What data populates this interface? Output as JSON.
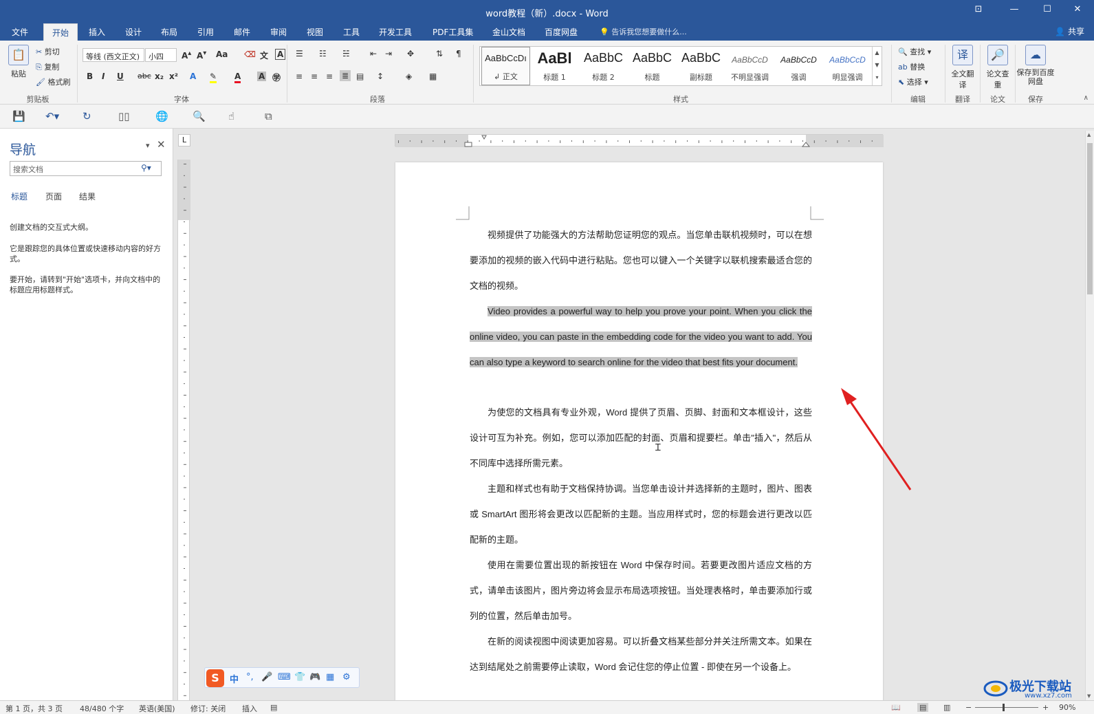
{
  "window": {
    "title": "word教程（新）.docx - Word",
    "controls": [
      "⊡",
      "—",
      "☐",
      "✕"
    ]
  },
  "tabs": [
    "文件",
    "开始",
    "插入",
    "设计",
    "布局",
    "引用",
    "邮件",
    "审阅",
    "视图",
    "工具",
    "开发工具",
    "PDF工具集",
    "金山文档",
    "百度网盘"
  ],
  "active_tab": "开始",
  "tellme": "告诉我您想要做什么...",
  "share": "共享",
  "ribbon": {
    "clipboard": {
      "paste": "粘贴",
      "cut": "剪切",
      "copy": "复制",
      "format_painter": "格式刷",
      "label": "剪贴板"
    },
    "font": {
      "name": "等线 (西文正文)",
      "size": "小四",
      "label": "字体"
    },
    "paragraph": {
      "label": "段落"
    },
    "styles": {
      "label": "样式",
      "items": [
        {
          "preview": "AaBbCcDı",
          "name": "↲ 正文"
        },
        {
          "preview": "AaBl",
          "name": "标题 1"
        },
        {
          "preview": "AaBbC",
          "name": "标题 2"
        },
        {
          "preview": "AaBbC",
          "name": "标题"
        },
        {
          "preview": "AaBbC",
          "name": "副标题"
        },
        {
          "preview": "AaBbCcD",
          "name": "不明显强调"
        },
        {
          "preview": "AaBbCcD",
          "name": "强调"
        },
        {
          "preview": "AaBbCcD",
          "name": "明显强调"
        }
      ]
    },
    "editing": {
      "find": "查找",
      "replace": "替换",
      "select": "选择",
      "label": "编辑"
    },
    "translate": {
      "btn": "全文翻译",
      "label": "翻译"
    },
    "paper": {
      "btn": "论文查重",
      "label": "论文"
    },
    "save": {
      "btn": "保存到百度网盘",
      "label": "保存"
    }
  },
  "nav": {
    "title": "导航",
    "search_placeholder": "搜索文档",
    "tabs": [
      "标题",
      "页面",
      "结果"
    ],
    "p1": "创建文档的交互式大纲。",
    "p2": "它是跟踪您的具体位置或快速移动内容的好方式。",
    "p3": "要开始，请转到\"开始\"选项卡，并向文档中的标题应用标题样式。"
  },
  "document": {
    "paragraphs": [
      "视频提供了功能强大的方法帮助您证明您的观点。当您单击联机视频时，可以在想要添加的视频的嵌入代码中进行粘贴。您也可以键入一个关键字以联机搜索最适合您的文档的视频。",
      "Video provides a powerful way to help you prove your point. When you click the online video, you can paste in the embedding code for the video you want to add. You can also type a keyword to search online for the video that best fits your document.",
      "为使您的文档具有专业外观，Word 提供了页眉、页脚、封面和文本框设计，这些设计可互为补充。例如，您可以添加匹配的封面、页眉和提要栏。单击\"插入\"，然后从不同库中选择所需元素。",
      "主题和样式也有助于文档保持协调。当您单击设计并选择新的主题时，图片、图表或 SmartArt 图形将会更改以匹配新的主题。当应用样式时，您的标题会进行更改以匹配新的主题。",
      "使用在需要位置出现的新按钮在 Word 中保存时间。若要更改图片适应文档的方式，请单击该图片，图片旁边将会显示布局选项按钮。当处理表格时，单击要添加行或列的位置，然后单击加号。",
      "在新的阅读视图中阅读更加容易。可以折叠文档某些部分并关注所需文本。如果在达到结尾处之前需要停止读取，Word 会记住您的停止位置 - 即使在另一个设备上。"
    ]
  },
  "ime": {
    "lang": "中"
  },
  "status": {
    "page": "第 1 页，共 3 页",
    "words": "48/480 个字",
    "lang": "英语(美国)",
    "track": "修订: 关闭",
    "mode": "插入",
    "zoom": "90%"
  },
  "watermark": {
    "name": "极光下载站",
    "url": "www.xz7.com"
  }
}
